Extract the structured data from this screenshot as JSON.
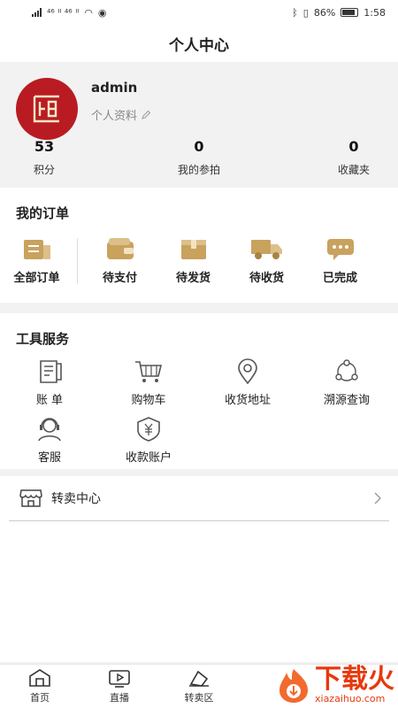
{
  "status_bar": {
    "left_text": "⁴⁶ ᴵᴵ ⁴⁶ ᴵᴵ",
    "battery": "86%",
    "time": "1:58"
  },
  "title": "个人中心",
  "profile": {
    "username": "admin",
    "info_link": "个人资料",
    "stats": [
      {
        "value": "53",
        "label": "积分"
      },
      {
        "value": "0",
        "label": "我的参拍"
      },
      {
        "value": "0",
        "label": "收藏夹"
      }
    ]
  },
  "orders": {
    "title": "我的订单",
    "items": [
      {
        "label": "全部订单",
        "icon": "all-orders-icon"
      },
      {
        "label": "待支付",
        "icon": "wallet-icon"
      },
      {
        "label": "待发货",
        "icon": "package-icon"
      },
      {
        "label": "待收货",
        "icon": "truck-icon"
      },
      {
        "label": "已完成",
        "icon": "chat-done-icon"
      }
    ]
  },
  "tools": {
    "title": "工具服务",
    "items": [
      {
        "label": "账 单",
        "icon": "bill-icon"
      },
      {
        "label": "购物车",
        "icon": "cart-icon"
      },
      {
        "label": "收货地址",
        "icon": "location-icon"
      },
      {
        "label": "溯源查询",
        "icon": "trace-icon"
      },
      {
        "label": "客服",
        "icon": "customer-service-icon"
      },
      {
        "label": "收款账户",
        "icon": "payment-account-icon"
      }
    ]
  },
  "resale": {
    "label": "转卖中心"
  },
  "bottom_nav": [
    {
      "label": "首页",
      "icon": "home-icon"
    },
    {
      "label": "直播",
      "icon": "live-icon"
    },
    {
      "label": "转卖区",
      "icon": "resale-icon"
    }
  ],
  "watermark": {
    "brand": "下载火",
    "domain": "xiazaihuo.com"
  },
  "colors": {
    "accent": "#b81c22",
    "order_icon": "#c9a25e",
    "watermark": "#e8380d"
  }
}
